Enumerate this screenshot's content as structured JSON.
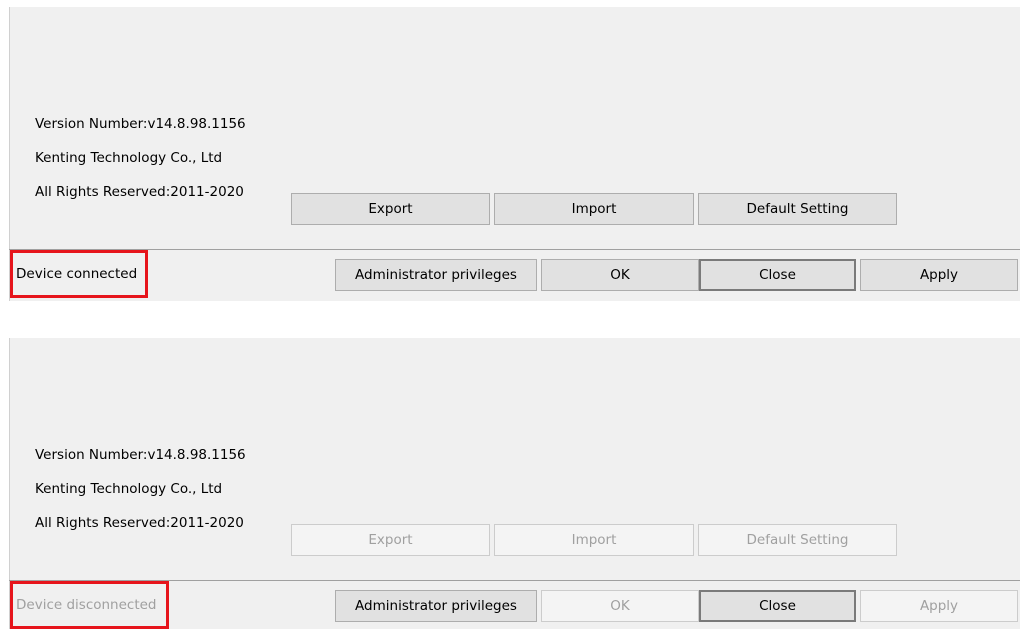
{
  "about": {
    "version": "Version Number:v14.8.98.1156",
    "company": "Kenting Technology Co., Ltd",
    "rights": "All Rights Reserved:2011-2020"
  },
  "buttons": {
    "export": "Export",
    "import": "Import",
    "default_setting": "Default Setting",
    "admin": "Administrator privileges",
    "ok": "OK",
    "close": "Close",
    "apply": "Apply"
  },
  "states": [
    {
      "status": "Device connected",
      "buttons_enabled": true
    },
    {
      "status": "Device disconnected",
      "buttons_enabled": false
    }
  ],
  "colors": {
    "highlight_border": "#e6141b",
    "panel_bg": "#f0f0f0",
    "disabled_text": "#a0a0a0"
  }
}
